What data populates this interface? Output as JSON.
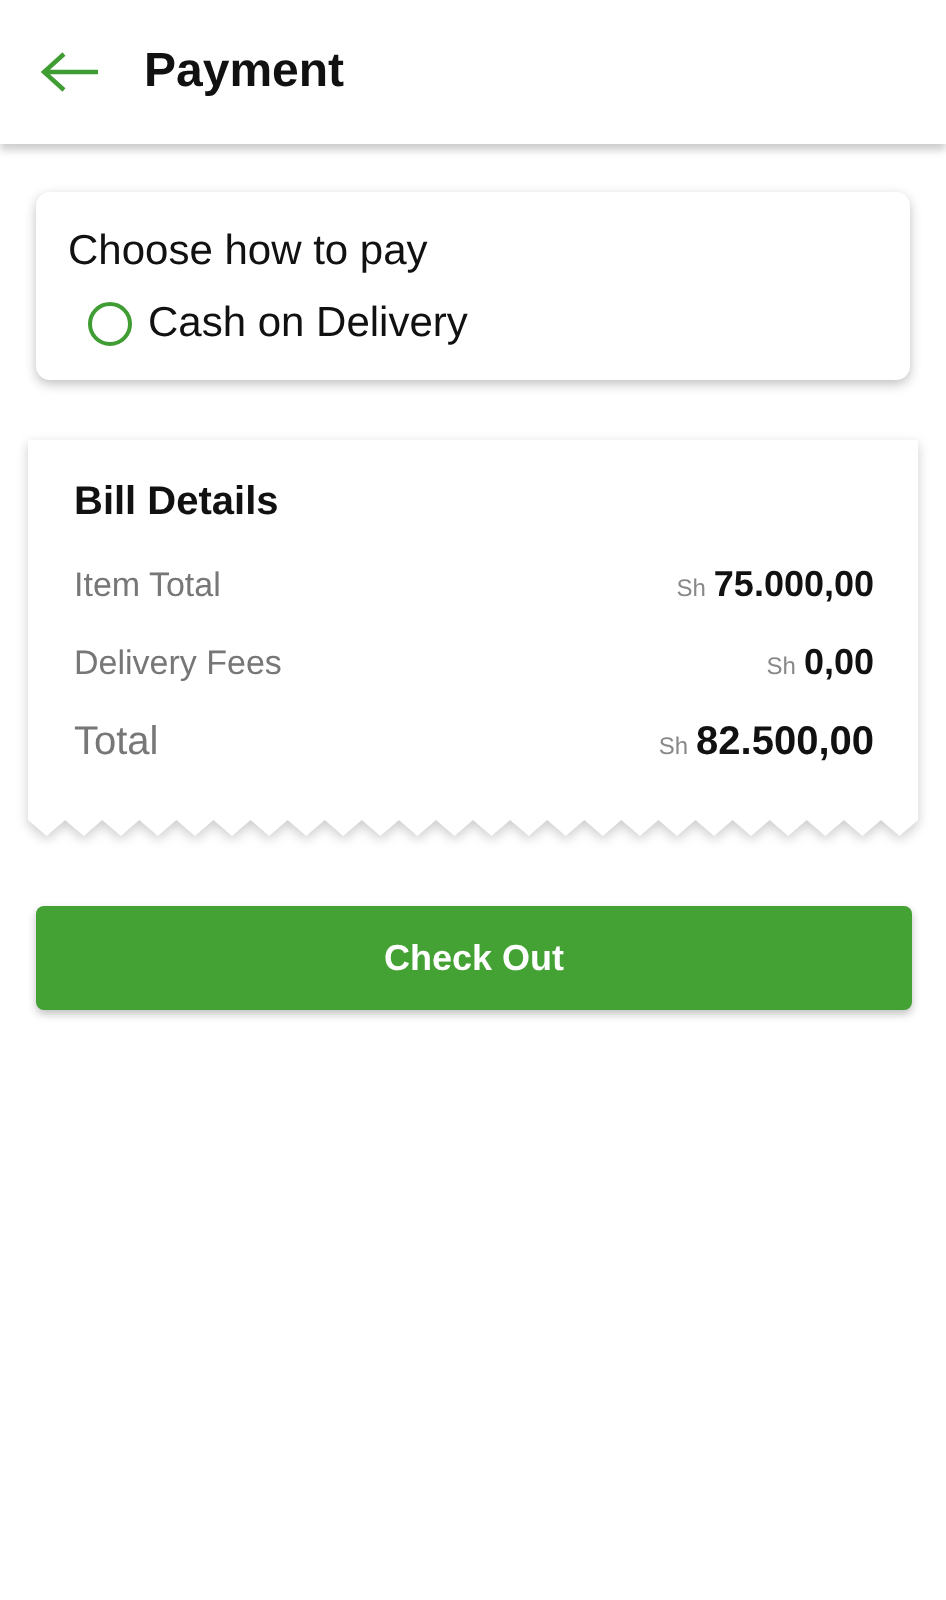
{
  "header": {
    "title": "Payment"
  },
  "payment": {
    "title": "Choose how to pay",
    "options": [
      {
        "label": "Cash on Delivery",
        "selected": false
      }
    ]
  },
  "bill": {
    "title": "Bill Details",
    "lines": [
      {
        "kind": "item",
        "label": "Item Total",
        "currency": "Sh",
        "amount": "75.000,00"
      },
      {
        "kind": "item",
        "label": "Delivery Fees",
        "currency": "Sh",
        "amount": "0,00"
      },
      {
        "kind": "total",
        "label": "Total",
        "currency": "Sh",
        "amount": "82.500,00"
      }
    ]
  },
  "button": {
    "label": "Check Out"
  }
}
